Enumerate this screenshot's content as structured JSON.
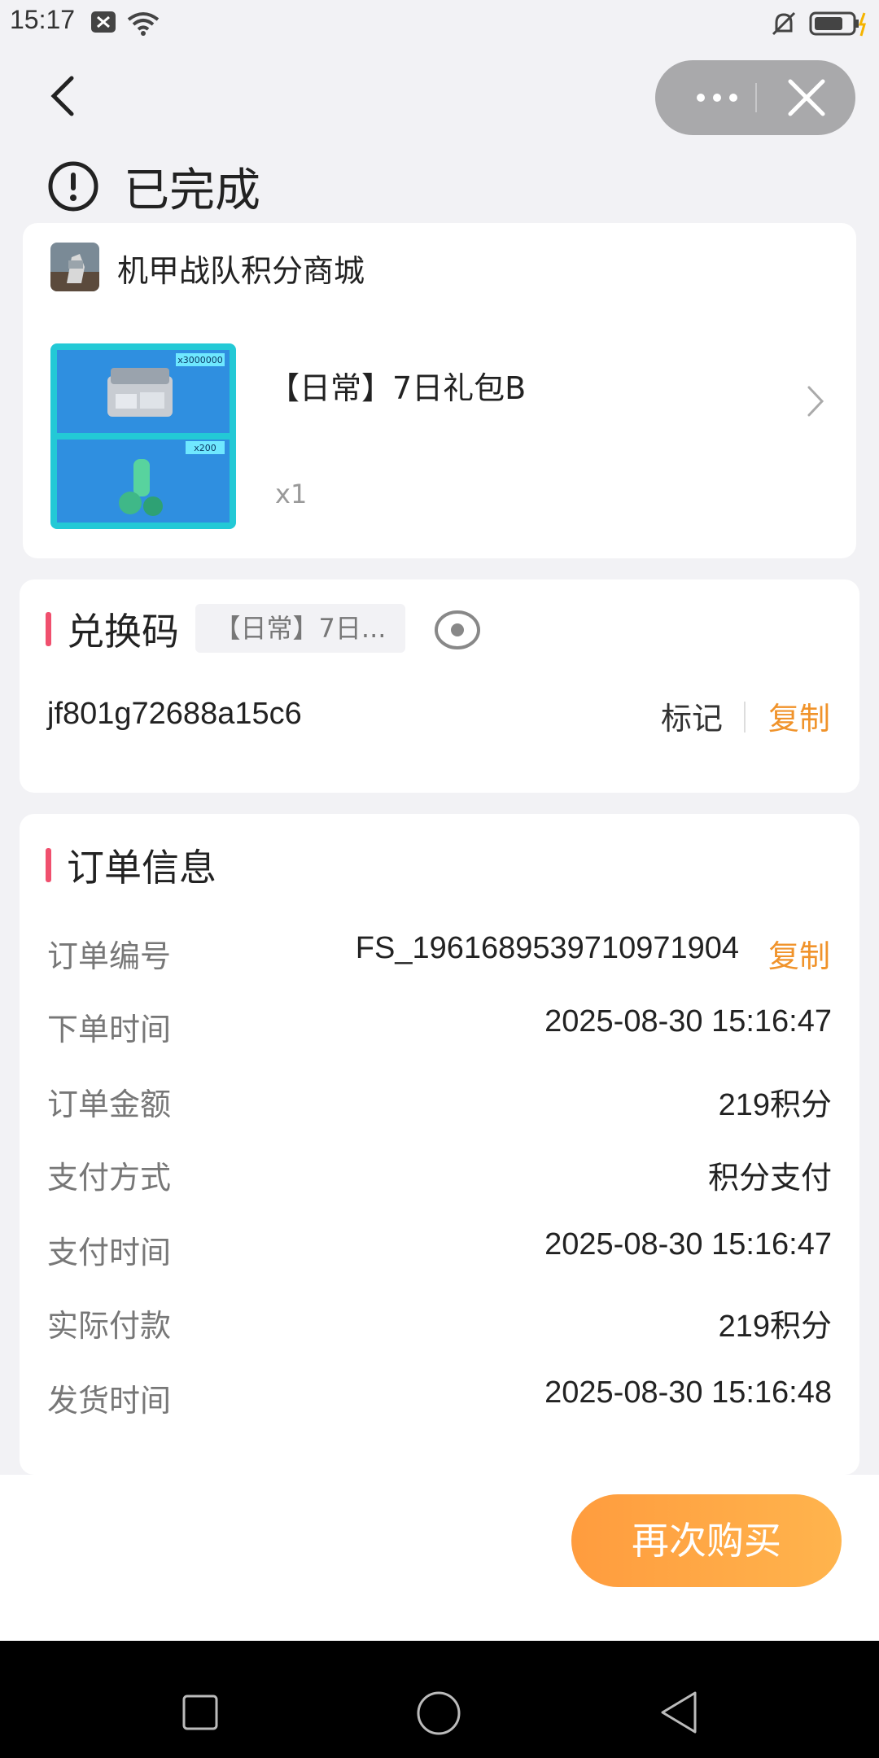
{
  "status_bar": {
    "time": "15:17"
  },
  "header": {
    "status_text": "已完成"
  },
  "shop": {
    "name": "机甲战队积分商城"
  },
  "product": {
    "title": "【日常】7日礼包B",
    "quantity": "x1",
    "image_labels": [
      "x3000000",
      "x200"
    ]
  },
  "redeem": {
    "title": "兑换码",
    "tag": "【日常】7日...",
    "code": "jf801g72688a15c6",
    "mark_label": "标记",
    "copy_label": "复制"
  },
  "order": {
    "title": "订单信息",
    "copy_label": "复制",
    "rows": [
      {
        "label": "订单编号",
        "value": "FS_1961689539710971904"
      },
      {
        "label": "下单时间",
        "value": "2025-08-30 15:16:47"
      },
      {
        "label": "订单金额",
        "value": "219积分"
      },
      {
        "label": "支付方式",
        "value": "积分支付"
      },
      {
        "label": "支付时间",
        "value": "2025-08-30 15:16:47"
      },
      {
        "label": "实际付款",
        "value": "219积分"
      },
      {
        "label": "发货时间",
        "value": "2025-08-30 15:16:48"
      }
    ]
  },
  "actions": {
    "buy_again": "再次购买"
  },
  "colors": {
    "accent": "#f0932b",
    "section_bar": "#f0506e",
    "button": "#ffa640"
  }
}
